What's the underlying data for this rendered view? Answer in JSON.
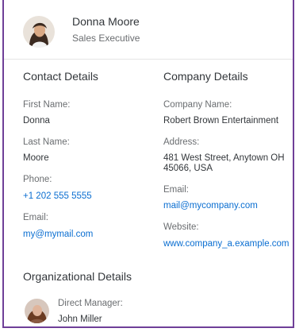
{
  "profile": {
    "name": "Donna Moore",
    "title": "Sales Executive",
    "avatar_icon": "person-photo-icon"
  },
  "contact": {
    "heading": "Contact Details",
    "first_name_label": "First Name:",
    "first_name": "Donna",
    "last_name_label": "Last Name:",
    "last_name": "Moore",
    "phone_label": "Phone:",
    "phone": "+1 202 555 5555",
    "email_label": "Email:",
    "email": "my@mymail.com"
  },
  "company": {
    "heading": "Company Details",
    "name_label": "Company Name:",
    "name": "Robert Brown Entertainment",
    "address_label": "Address:",
    "address_line1": "481 West Street, Anytown OH",
    "address_line2": "45066, USA",
    "email_label": "Email:",
    "email": "mail@mycompany.com",
    "website_label": "Website:",
    "website": "www.company_a.example.com"
  },
  "organization": {
    "heading": "Organizational Details",
    "manager_label": "Direct Manager:",
    "manager_name": "John Miller"
  },
  "colors": {
    "link": "#0a6ed1",
    "frame": "#6f3f98"
  }
}
